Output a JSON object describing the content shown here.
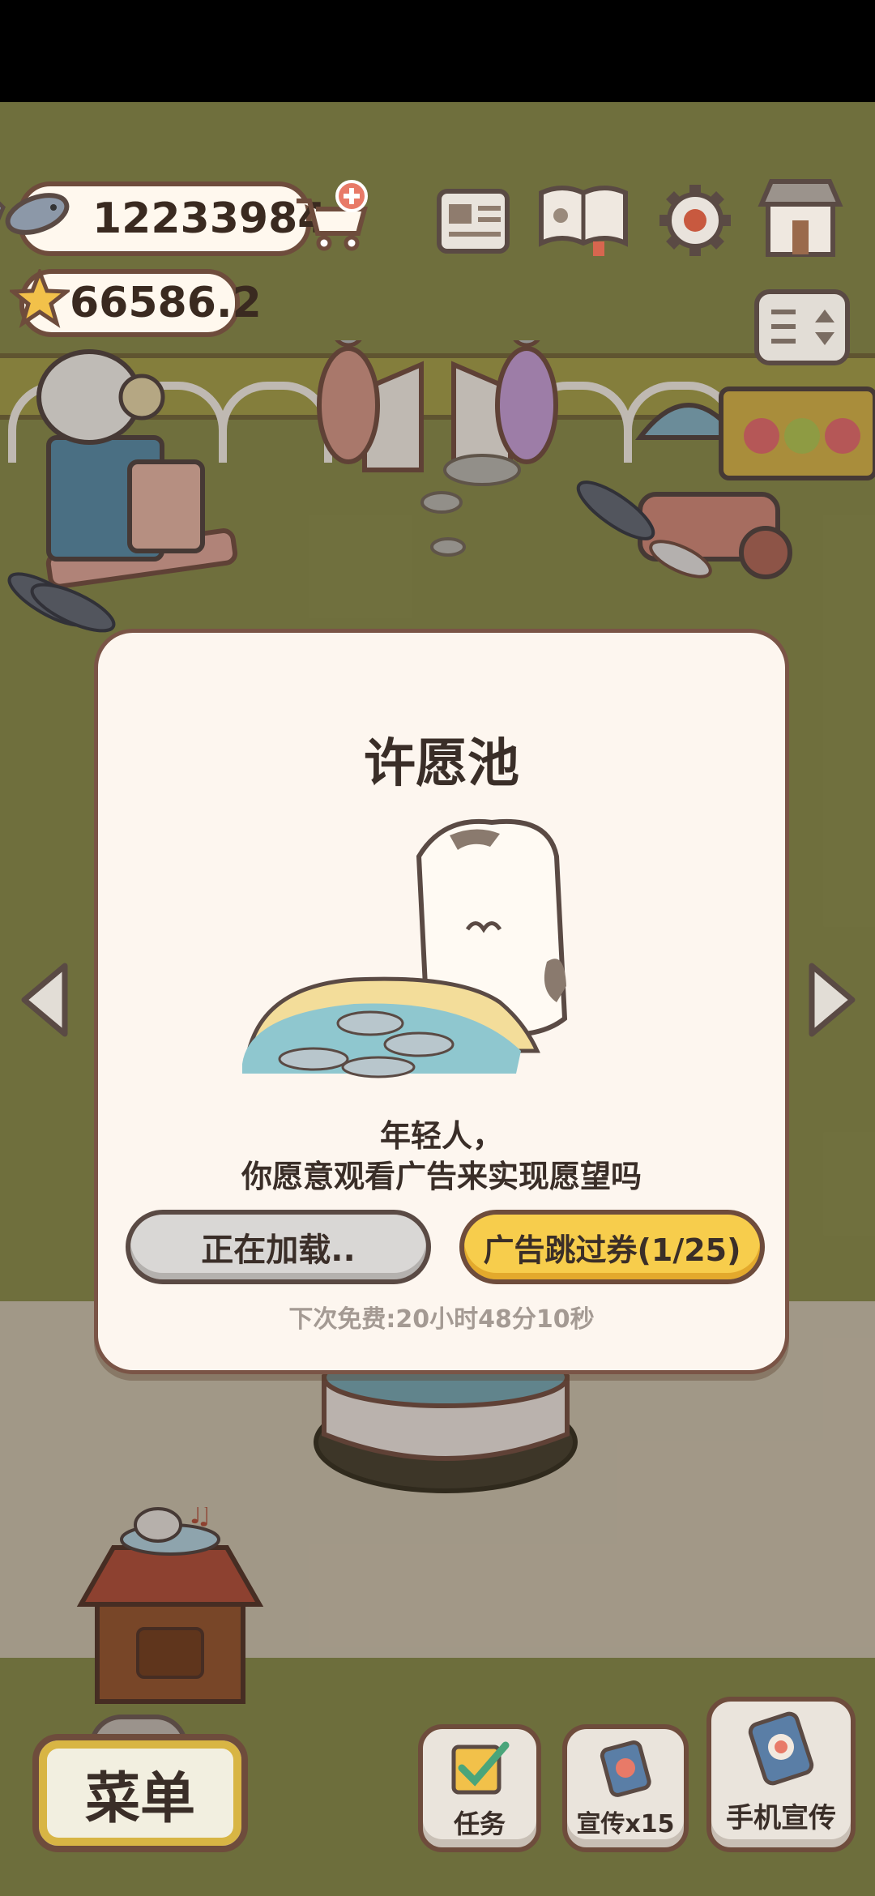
{
  "currency": {
    "fish": "12233984",
    "stars": "66586.2"
  },
  "dialog": {
    "title": "许愿池",
    "line1": "年轻人，",
    "line2": "你愿意观看广告来实现愿望吗",
    "loading_button": "正在加载..",
    "skip_button": "广告跳过券(1/25)",
    "next_free": "下次免费:20小时48分10秒"
  },
  "bottom_bar": {
    "menu": "菜单",
    "tasks": "任务",
    "promote": "宣传x15",
    "phone_promote": "手机宣传"
  },
  "colors": {
    "accent_yellow": "#f7cd4c",
    "border_brown": "#6e4c3c",
    "dialog_bg": "#fdf6ef",
    "grass": "#8f8f4f"
  }
}
